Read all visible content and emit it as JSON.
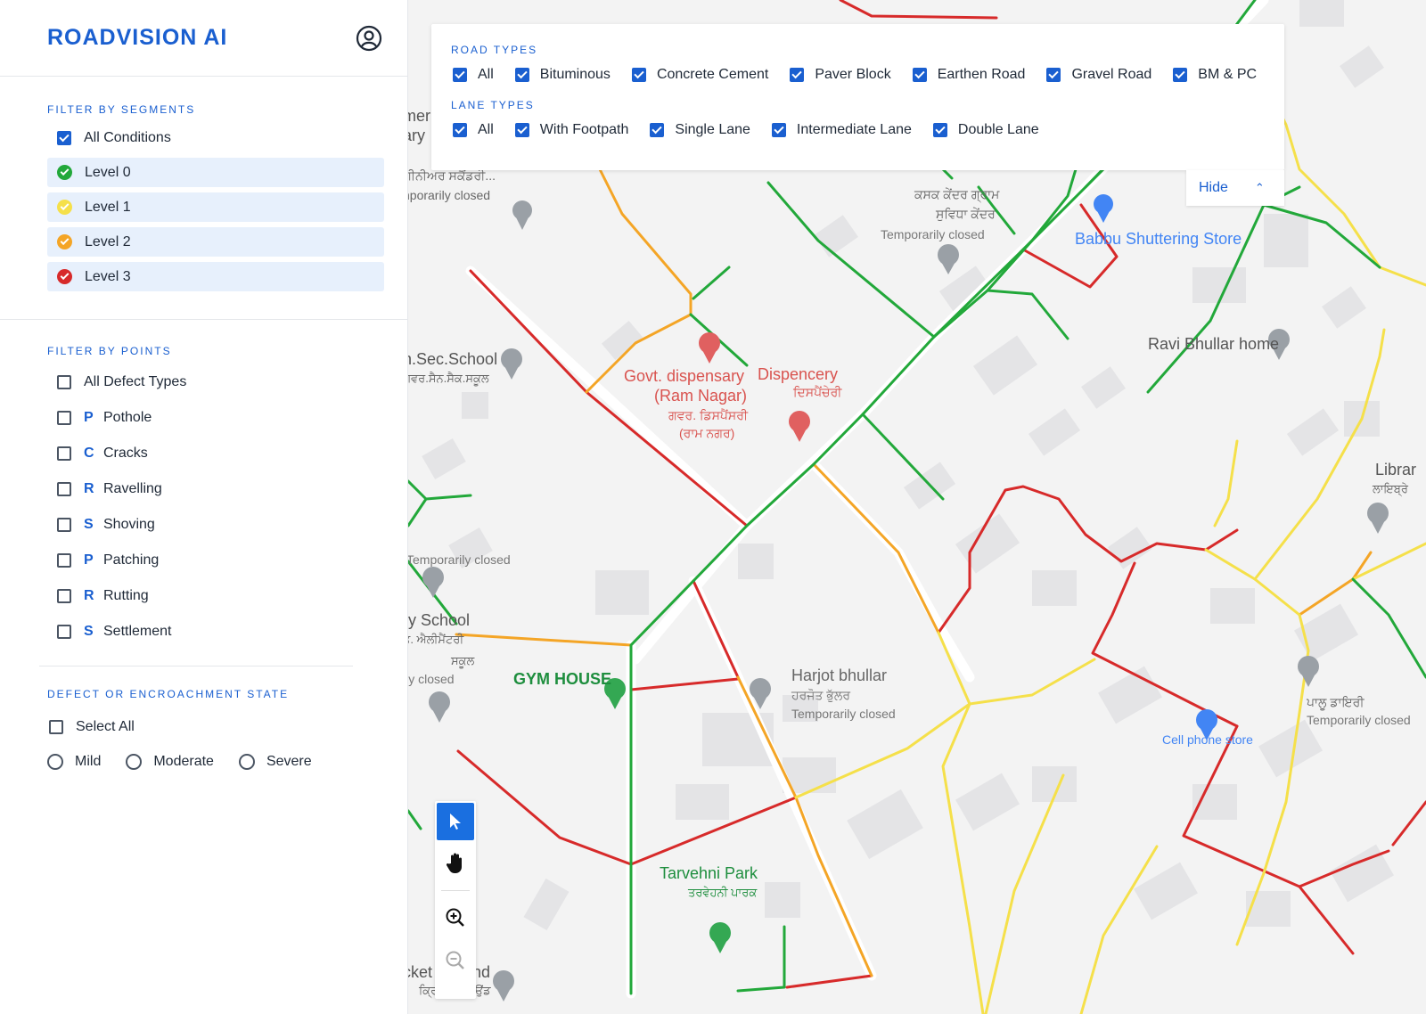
{
  "brand": {
    "logo_text": "ROADVISION AI",
    "accent": "#1a5fd0"
  },
  "user_icon": "user-circle-icon",
  "segments": {
    "title": "FILTER BY SEGMENTS",
    "all_label": "All Conditions",
    "all_checked": true,
    "levels": [
      {
        "label": "Level 0",
        "color": "#22a83a"
      },
      {
        "label": "Level 1",
        "color": "#f5e04a"
      },
      {
        "label": "Level 2",
        "color": "#f4a526"
      },
      {
        "label": "Level 3",
        "color": "#d72a2a"
      }
    ]
  },
  "points": {
    "title": "FILTER BY POINTS",
    "all_label": "All Defect Types",
    "items": [
      {
        "letter": "P",
        "label": "Pothole"
      },
      {
        "letter": "C",
        "label": "Cracks"
      },
      {
        "letter": "R",
        "label": "Ravelling"
      },
      {
        "letter": "S",
        "label": "Shoving"
      },
      {
        "letter": "P",
        "label": "Patching"
      },
      {
        "letter": "R",
        "label": "Rutting"
      },
      {
        "letter": "S",
        "label": "Settlement"
      }
    ]
  },
  "state": {
    "title": "DEFECT OR ENCROACHMENT STATE",
    "select_all": "Select All",
    "options": [
      "Mild",
      "Moderate",
      "Severe"
    ]
  },
  "filter_panel": {
    "road_types_title": "ROAD TYPES",
    "road_types": [
      "All",
      "Bituminous",
      "Concrete Cement",
      "Paver Block",
      "Earthen Road",
      "Gravel Road",
      "BM & PC"
    ],
    "lane_types_title": "LANE TYPES",
    "lane_types": [
      "All",
      "With Footpath",
      "Single Lane",
      "Intermediate Lane",
      "Double Lane"
    ],
    "hide_label": "Hide"
  },
  "tools": [
    "cursor-icon",
    "hand-icon",
    "zoom-in-icon",
    "zoom-out-icon"
  ],
  "map": {
    "labels": {
      "sec_school": "n.Sec.School",
      "sec_school_pa": "ਗਵਰ.ਸੈਨ.ਸੈਕ.ਸਕੂਲ",
      "govt_disp_1": "Govt. dispensary",
      "govt_disp_2": "(Ram Nagar)",
      "govt_disp_pa1": "ਗਵਰ. ਡਿਸਪੈਂਸਰੀ",
      "govt_disp_pa2": "(ਰਾਮ ਨਗਰ)",
      "dispencery": "Dispencery",
      "dispencery_pa": "ਦਿਸਪੈਂਚੇਰੀ",
      "kasak_1": "ਕਸਕ ਕੇਂਦਰ ਗ੍ਰਾਮ",
      "kasak_2": "ਸੁਵਿਧਾ ਕੇਂਦਰ",
      "kasak_closed": "Temporarily closed",
      "babbu": "Babbu Shuttering Store",
      "ravi": "Ravi Bhullar home",
      "library": "Librar",
      "library_pa": "ਲਾਇਬ੍ਰੇ",
      "temp_closed_left": "Temporarily closed",
      "ry_school": "ry School",
      "ry_school_pa1": "ਤ. ਐਲੀਮੈਂਟਰੀ",
      "ry_school_pa2": "ਸਕੂਲ",
      "ry_school_closed": "ily closed",
      "gym": "GYM HOUSE",
      "harjot": "Harjot bhullar",
      "harjot_pa": "ਹਰਜੋਤ ਭੁੱਲਰ",
      "harjot_closed": "Temporarily closed",
      "cell": "Cell phone store",
      "dairy_pa": "ਪਾਲੂ ਡਾਇਰੀ",
      "dairy_closed": "Temporarily closed",
      "tarvehni": "Tarvehni Park",
      "tarvehni_pa": "ਤਰਵੇਹਨੀ ਪਾਰਕ",
      "cricket": "cket Ground",
      "cricket_pa": "ਕ੍ਰਿਕਟ ਗ੍ਰਾਉਂਡ",
      "top_left_1": "mer",
      "top_left_2": "ary",
      "top_left_3": "ਗੀਨੀਅਰ ਸਕੈਂਡਰੀ...",
      "top_left_4": "nporarily closed"
    }
  }
}
